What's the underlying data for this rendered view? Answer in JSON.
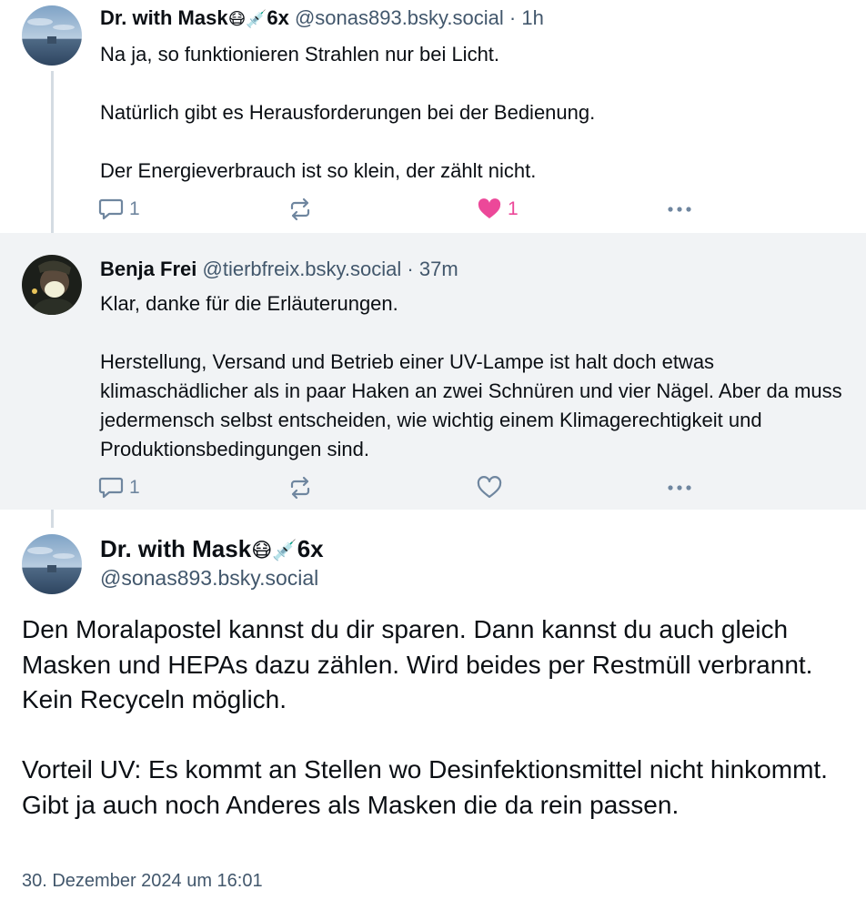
{
  "posts": [
    {
      "author_name": "Dr. with Mask",
      "author_emoji": "😷💉",
      "author_suffix": "6x",
      "handle": "@sonas893.bsky.social",
      "separator": "·",
      "age": "1h",
      "text": "Na ja, so funktionieren Strahlen nur bei Licht.\n\nNatürlich gibt es Herausforderungen bei der Bedienung.\n\nDer Energieverbrauch ist so klein, der zählt nicht.",
      "reply_count": "1",
      "like_count": "1",
      "liked": true
    },
    {
      "author_name": "Benja Frei",
      "handle": "@tierbfreix.bsky.social",
      "separator": "·",
      "age": "37m",
      "text": "Klar, danke für die Erläuterungen.\n\nHerstellung, Versand und Betrieb einer UV-Lampe ist halt doch etwas klimaschädlicher als in paar Haken an zwei Schnüren und vier Nägel. Aber da muss jedermensch selbst entscheiden, wie wichtig einem Klimagerechtigkeit und Produktionsbedingungen sind.",
      "reply_count": "1",
      "liked": false
    }
  ],
  "main_post": {
    "author_name": "Dr. with Mask",
    "author_emoji": "😷💉",
    "author_suffix": "6x",
    "handle": "@sonas893.bsky.social",
    "text": "Den Moralapostel kannst du dir sparen. Dann kannst du auch gleich Masken und HEPAs dazu zählen. Wird beides per Restmüll verbrannt. Kein Recyceln möglich.\n\nVorteil UV: Es kommt an Stellen wo Desinfektionsmittel nicht hinkommt. Gibt ja auch noch Anderes als Masken die da rein passen.",
    "timestamp": "30. Dezember 2024 um 16:01"
  },
  "icons": {
    "reply": "reply-bubble-icon",
    "repost": "repost-arrows-icon",
    "like": "heart-icon",
    "more": "ellipsis-icon"
  },
  "colors": {
    "accent_like": "#ec4899",
    "muted": "#6f869f",
    "handle": "#42576c",
    "highlight_bg": "#f1f3f5",
    "thread_line": "#d4dbe2"
  }
}
